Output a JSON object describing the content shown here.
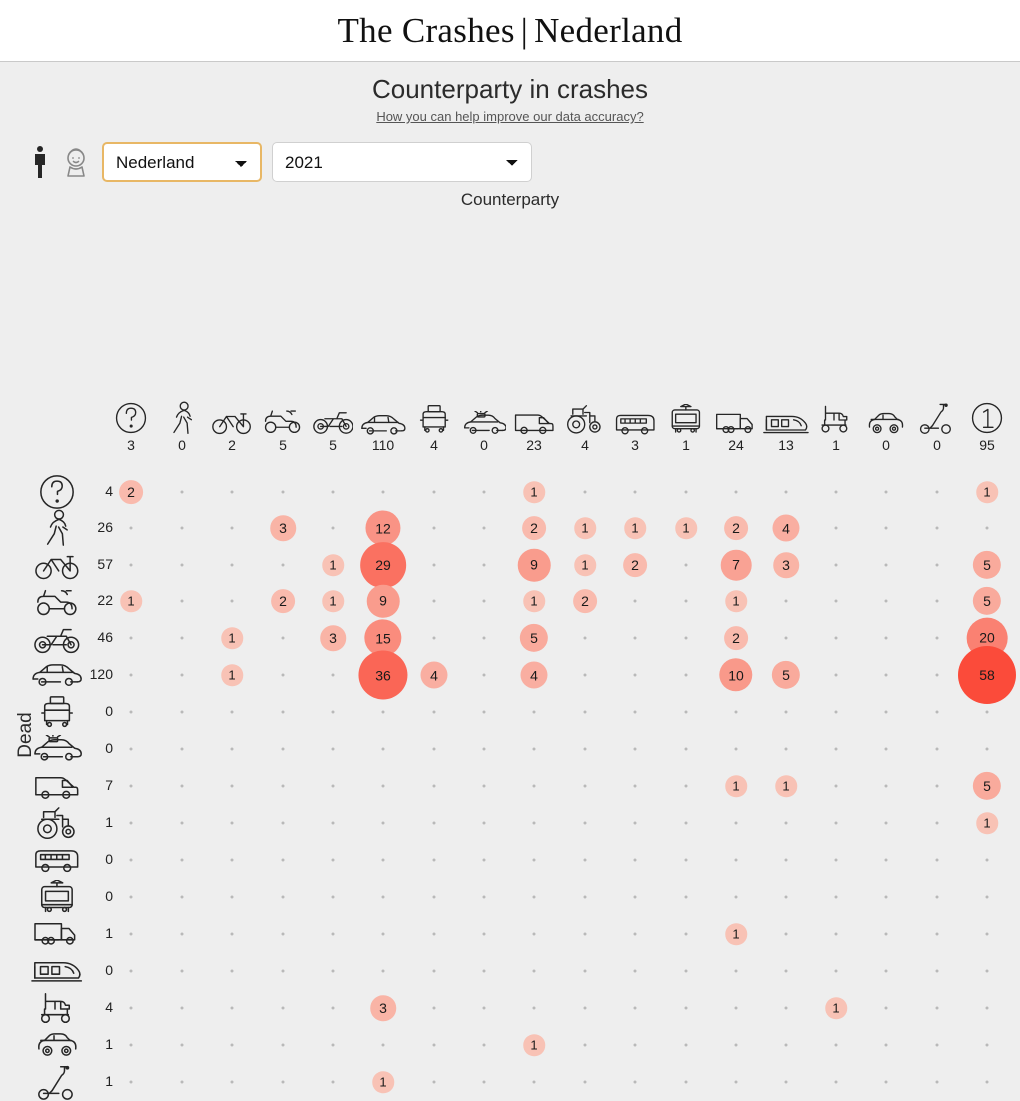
{
  "masthead": {
    "title_main": "The Crashes",
    "separator": "|",
    "title_region": "Nederland"
  },
  "header": {
    "chart_title": "Counterparty in crashes",
    "accuracy_link": "How you can help improve our data accuracy?"
  },
  "controls": {
    "adult_icon": "adult-person-icon",
    "child_icon": "child-face-icon",
    "country_value": "Nederland",
    "country_options": [
      "Nederland"
    ],
    "year_value": "2021",
    "year_options": [
      "2021"
    ]
  },
  "axes": {
    "x_label": "Counterparty",
    "y_label": "Dead"
  },
  "colors": {
    "background": "#eeeeee",
    "masthead_background": "#ffffff",
    "bubble_max": "#fb4b3a",
    "bubble_min": "#f8d9cd",
    "dot": "#b9b9b9",
    "country_select_border": "#e8b765",
    "text": "#222222"
  },
  "chart_data": {
    "type": "heatmap",
    "title": "Counterparty in crashes",
    "xlabel": "Counterparty",
    "ylabel": "Dead",
    "categories": [
      "unknown",
      "pedestrian",
      "bicycle",
      "moped",
      "motorcycle",
      "car",
      "taxi",
      "police-car",
      "van",
      "tractor",
      "bus",
      "tram",
      "truck",
      "train",
      "mobility-scooter",
      "microcar",
      "e-scooter",
      "single-vehicle"
    ],
    "category_icons": [
      "question-mark-icon",
      "pedestrian-icon",
      "bicycle-icon",
      "moped-icon",
      "motorcycle-icon",
      "car-icon",
      "taxi-icon",
      "police-car-icon",
      "van-icon",
      "tractor-icon",
      "bus-icon",
      "tram-icon",
      "truck-icon",
      "train-icon",
      "mobility-scooter-icon",
      "microcar-icon",
      "e-scooter-icon",
      "circled-one-icon"
    ],
    "column_totals": [
      3,
      0,
      2,
      5,
      5,
      110,
      4,
      0,
      23,
      4,
      3,
      1,
      24,
      13,
      1,
      0,
      0,
      95
    ],
    "rows": [
      "unknown",
      "pedestrian",
      "bicycle",
      "moped",
      "motorcycle",
      "car",
      "taxi",
      "police-car",
      "van",
      "tractor",
      "bus",
      "tram",
      "truck",
      "train",
      "mobility-scooter",
      "microcar",
      "e-scooter"
    ],
    "row_icons": [
      "question-mark-icon",
      "pedestrian-icon",
      "bicycle-icon",
      "moped-icon",
      "motorcycle-icon",
      "car-icon",
      "taxi-icon",
      "police-car-icon",
      "van-icon",
      "tractor-icon",
      "bus-icon",
      "tram-icon",
      "truck-icon",
      "train-icon",
      "mobility-scooter-icon",
      "microcar-icon",
      "e-scooter-icon"
    ],
    "row_totals": [
      4,
      26,
      57,
      22,
      46,
      120,
      0,
      0,
      7,
      1,
      0,
      0,
      1,
      0,
      4,
      1,
      1
    ],
    "values": [
      [
        2,
        0,
        0,
        0,
        0,
        0,
        0,
        0,
        1,
        0,
        0,
        0,
        0,
        0,
        0,
        0,
        0,
        1
      ],
      [
        0,
        0,
        0,
        3,
        0,
        12,
        0,
        0,
        2,
        1,
        1,
        1,
        2,
        4,
        0,
        0,
        0,
        0
      ],
      [
        0,
        0,
        0,
        0,
        1,
        29,
        0,
        0,
        9,
        1,
        2,
        0,
        7,
        3,
        0,
        0,
        0,
        5
      ],
      [
        1,
        0,
        0,
        2,
        1,
        9,
        0,
        0,
        1,
        2,
        0,
        0,
        1,
        0,
        0,
        0,
        0,
        5
      ],
      [
        0,
        0,
        1,
        0,
        3,
        15,
        0,
        0,
        5,
        0,
        0,
        0,
        2,
        0,
        0,
        0,
        0,
        20
      ],
      [
        0,
        0,
        1,
        0,
        0,
        36,
        4,
        0,
        4,
        0,
        0,
        0,
        10,
        5,
        0,
        0,
        0,
        58
      ],
      [
        0,
        0,
        0,
        0,
        0,
        0,
        0,
        0,
        0,
        0,
        0,
        0,
        0,
        0,
        0,
        0,
        0,
        0
      ],
      [
        0,
        0,
        0,
        0,
        0,
        0,
        0,
        0,
        0,
        0,
        0,
        0,
        0,
        0,
        0,
        0,
        0,
        0
      ],
      [
        0,
        0,
        0,
        0,
        0,
        0,
        0,
        0,
        0,
        0,
        0,
        0,
        1,
        1,
        0,
        0,
        0,
        5
      ],
      [
        0,
        0,
        0,
        0,
        0,
        0,
        0,
        0,
        0,
        0,
        0,
        0,
        0,
        0,
        0,
        0,
        0,
        1
      ],
      [
        0,
        0,
        0,
        0,
        0,
        0,
        0,
        0,
        0,
        0,
        0,
        0,
        0,
        0,
        0,
        0,
        0,
        0
      ],
      [
        0,
        0,
        0,
        0,
        0,
        0,
        0,
        0,
        0,
        0,
        0,
        0,
        0,
        0,
        0,
        0,
        0,
        0
      ],
      [
        0,
        0,
        0,
        0,
        0,
        0,
        0,
        0,
        0,
        0,
        0,
        0,
        1,
        0,
        0,
        0,
        0,
        0
      ],
      [
        0,
        0,
        0,
        0,
        0,
        0,
        0,
        0,
        0,
        0,
        0,
        0,
        0,
        0,
        0,
        0,
        0,
        0
      ],
      [
        0,
        0,
        0,
        0,
        0,
        3,
        0,
        0,
        0,
        0,
        0,
        0,
        0,
        0,
        1,
        0,
        0,
        0
      ],
      [
        0,
        0,
        0,
        0,
        0,
        0,
        0,
        0,
        1,
        0,
        0,
        0,
        0,
        0,
        0,
        0,
        0,
        0
      ],
      [
        0,
        0,
        0,
        0,
        0,
        1,
        0,
        0,
        0,
        0,
        0,
        0,
        0,
        0,
        0,
        0,
        0,
        0
      ]
    ],
    "max_value": 58
  }
}
